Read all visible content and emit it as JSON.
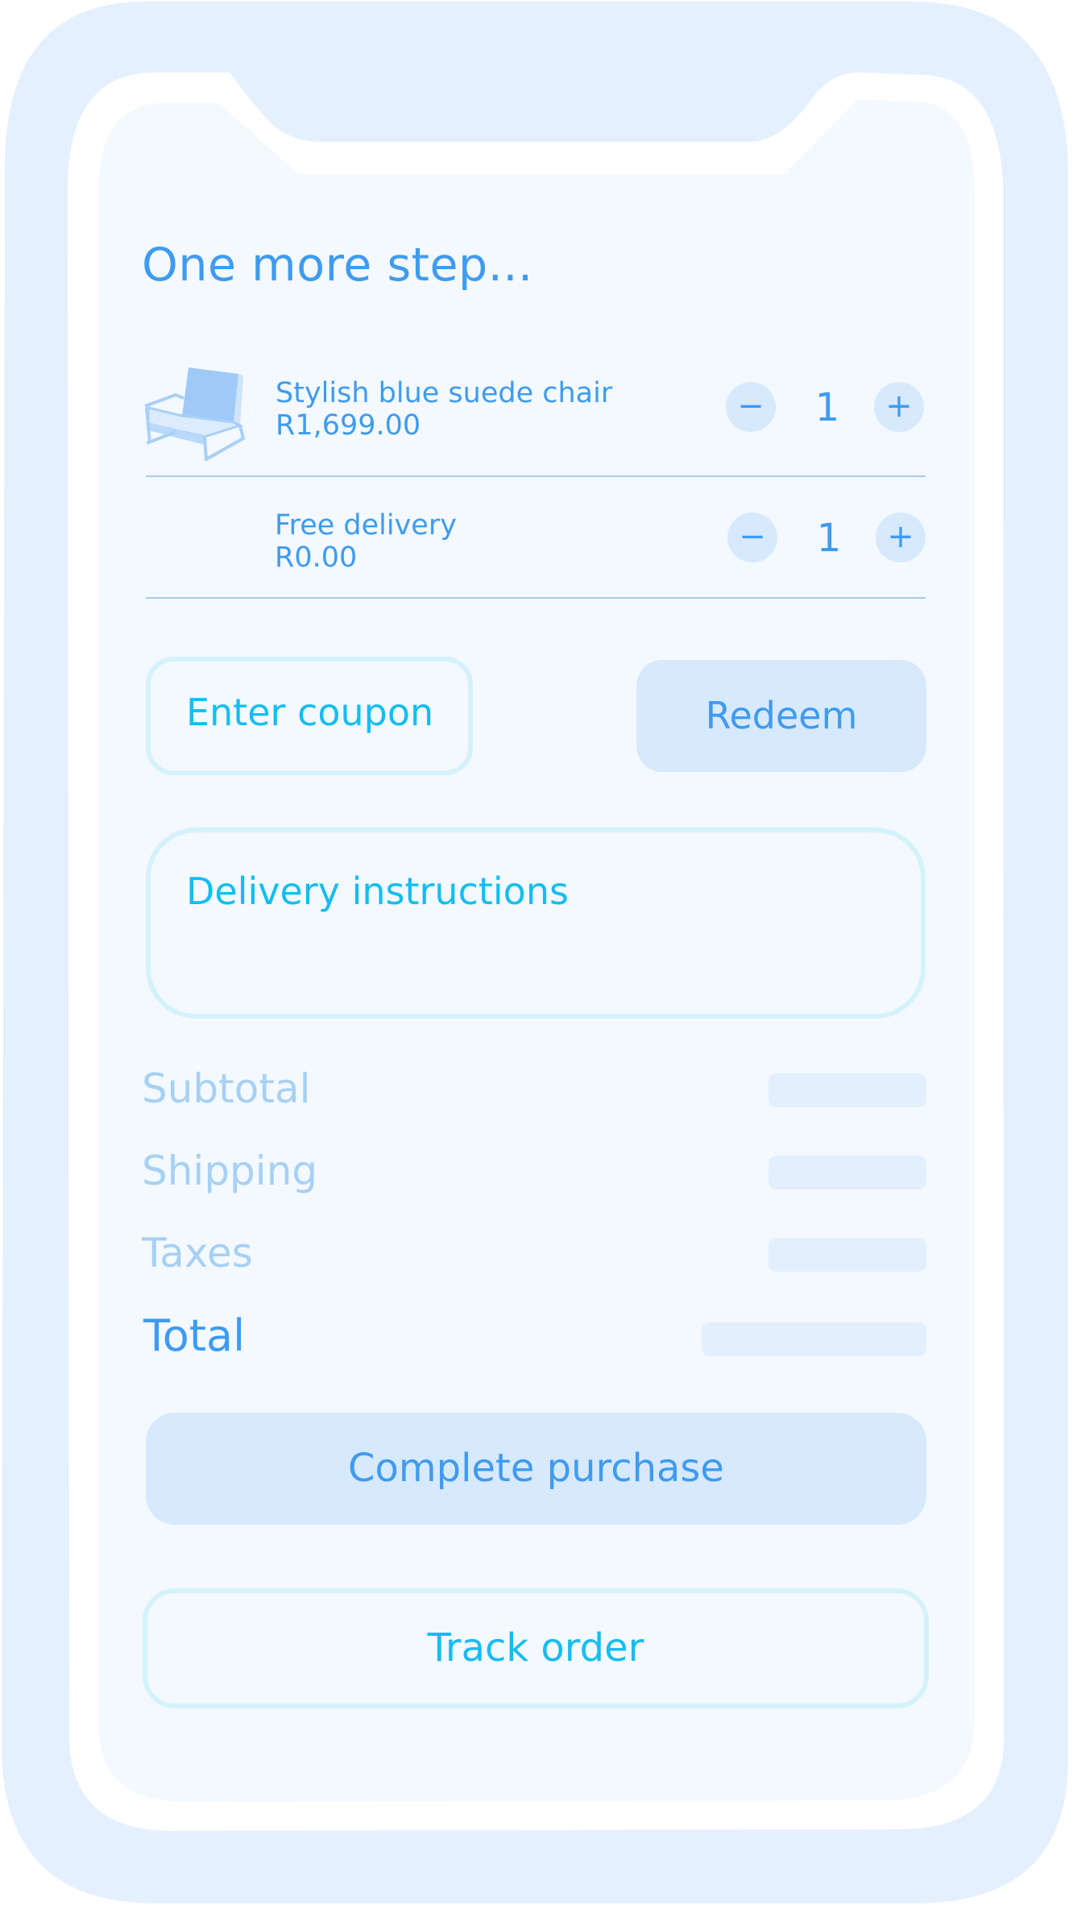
{
  "header": {
    "title": "One more step..."
  },
  "cart": {
    "items": [
      {
        "name": "Stylish blue suede chair",
        "price": "R1,699.00",
        "quantity": "1",
        "minus": "−",
        "plus": "+"
      },
      {
        "name": "Free delivery",
        "price": "R0.00",
        "quantity": "1",
        "minus": "−",
        "plus": "+"
      }
    ]
  },
  "coupon": {
    "placeholder": "Enter coupon",
    "redeem_label": "Redeem"
  },
  "delivery": {
    "placeholder": "Delivery instructions"
  },
  "summary": {
    "subtotal_label": "Subtotal",
    "shipping_label": "Shipping",
    "taxes_label": "Taxes",
    "total_label": "Total"
  },
  "actions": {
    "complete_label": "Complete purchase",
    "track_label": "Track order"
  },
  "colors": {
    "accent": "#3f9bf0",
    "cyan": "#13bdf2",
    "frame": "#e4f0fd",
    "screen": "#f3f9fe"
  }
}
